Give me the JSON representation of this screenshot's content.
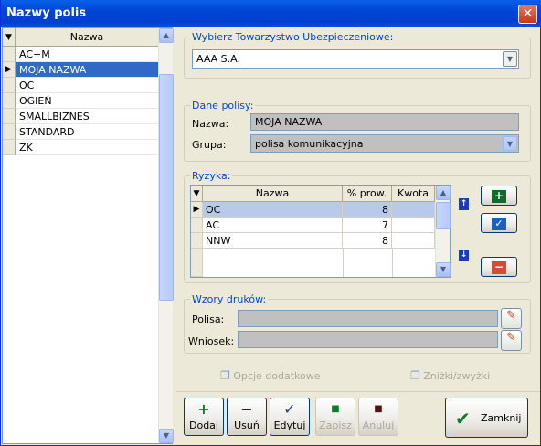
{
  "window": {
    "title": "Nazwy polis",
    "close_icon": "close-icon"
  },
  "left_grid": {
    "column": "Nazwa",
    "rows": [
      "AC+M",
      "MOJA NAZWA",
      "OC",
      "OGIEŃ",
      "SMALLBIZNES",
      "STANDARD",
      "ZK"
    ],
    "selected_index": 1
  },
  "insurer": {
    "label": "Wybierz Towarzystwo Ubezpieczeniowe:",
    "value": "AAA S.A."
  },
  "policy": {
    "label": "Dane polisy:",
    "name_label": "Nazwa:",
    "name_value": "MOJA NAZWA",
    "group_label": "Grupa:",
    "group_value": "polisa komunikacyjna"
  },
  "risks": {
    "label": "Ryzyka:",
    "columns": [
      "Nazwa",
      "% prow.",
      "Kwota"
    ],
    "rows": [
      {
        "name": "OC",
        "percent": "8",
        "amount": ""
      },
      {
        "name": "AC",
        "percent": "7",
        "amount": ""
      },
      {
        "name": "NNW",
        "percent": "8",
        "amount": ""
      }
    ]
  },
  "prints": {
    "label": "Wzory druków:",
    "policy_label": "Polisa:",
    "policy_value": "",
    "request_label": "Wniosek:",
    "request_value": ""
  },
  "options": {
    "extra_label": "Opcje dodatkowe",
    "discounts_label": "Zniżki/zwyżki"
  },
  "toolbar": {
    "add_label": "Dodaj",
    "delete_label": "Usuń",
    "edit_label": "Edytuj",
    "save_label": "Zapisz",
    "cancel_label": "Anuluj",
    "close_label": "Zamknij"
  },
  "colors": {
    "selection": "#316ac5",
    "title_bar": "#0a5fe8",
    "group_label": "#0046d5",
    "add_green": "#0f7a2a",
    "remove_red": "#d64a3a"
  }
}
